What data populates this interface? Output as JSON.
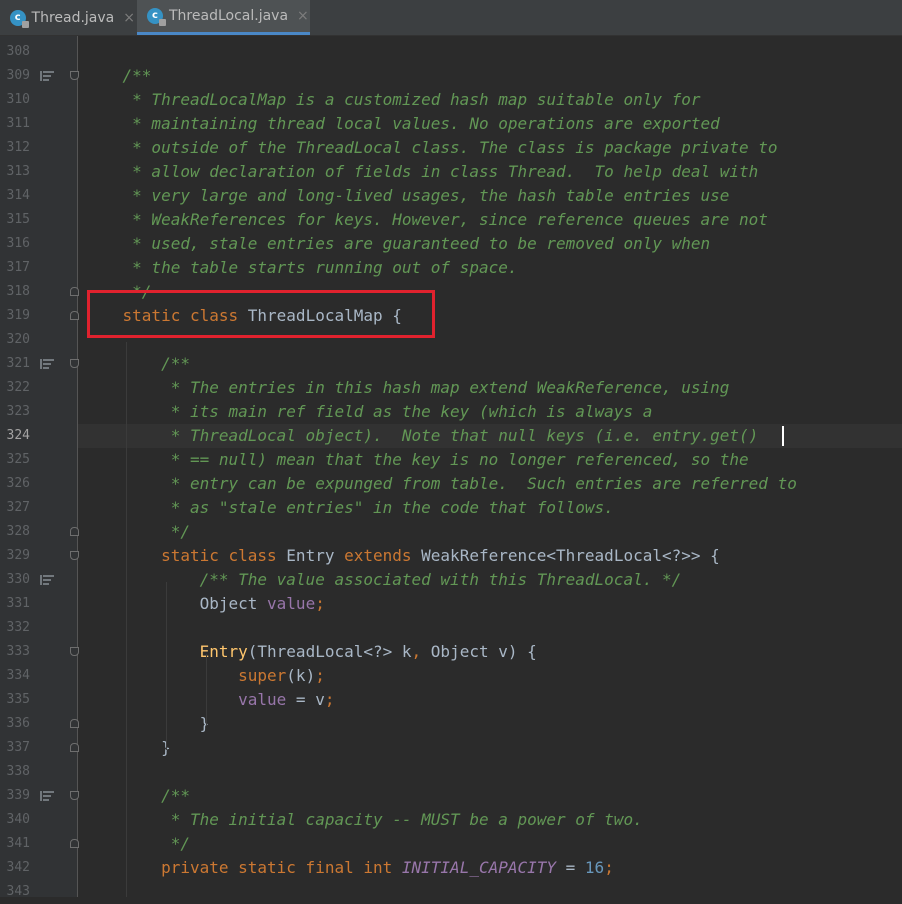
{
  "tabs": [
    {
      "label": "Thread.java",
      "icon": "java-class-icon",
      "active": false
    },
    {
      "label": "ThreadLocal.java",
      "icon": "java-class-icon",
      "active": true
    }
  ],
  "tab_close_glyph": "×",
  "file_icon_letter": "c",
  "colors": {
    "comment": "#629755",
    "keyword": "#cc7832",
    "field": "#9876aa",
    "number": "#6897bb",
    "method": "#ffc66d",
    "text": "#a9b7c6",
    "highlight_box": "#e0222e"
  },
  "current_line": 324,
  "highlighted_line": 319,
  "lines": [
    {
      "n": "308",
      "t": []
    },
    {
      "n": "309",
      "t": [
        [
          "comment",
          "    /**"
        ]
      ]
    },
    {
      "n": "310",
      "t": [
        [
          "comment",
          "     * ThreadLocalMap is a customized hash map suitable only for"
        ]
      ]
    },
    {
      "n": "311",
      "t": [
        [
          "comment",
          "     * maintaining thread local values. No operations are exported"
        ]
      ]
    },
    {
      "n": "312",
      "t": [
        [
          "comment",
          "     * outside of the ThreadLocal class. The class is package private to"
        ]
      ]
    },
    {
      "n": "313",
      "t": [
        [
          "comment",
          "     * allow declaration of fields in class Thread.  To help deal with"
        ]
      ]
    },
    {
      "n": "314",
      "t": [
        [
          "comment",
          "     * very large and long-lived usages, the hash table entries use"
        ]
      ]
    },
    {
      "n": "315",
      "t": [
        [
          "comment",
          "     * WeakReferences for keys. However, since reference queues are not"
        ]
      ]
    },
    {
      "n": "316",
      "t": [
        [
          "comment",
          "     * used, stale entries are guaranteed to be removed only when"
        ]
      ]
    },
    {
      "n": "317",
      "t": [
        [
          "comment",
          "     * the table starts running out of space."
        ]
      ]
    },
    {
      "n": "318",
      "t": [
        [
          "comment",
          "     */"
        ]
      ]
    },
    {
      "n": "319",
      "t": [
        [
          "kw",
          "    static class "
        ],
        [
          "plain",
          "ThreadLocalMap {"
        ]
      ]
    },
    {
      "n": "320",
      "t": []
    },
    {
      "n": "321",
      "t": [
        [
          "comment",
          "        /**"
        ]
      ]
    },
    {
      "n": "322",
      "t": [
        [
          "comment",
          "         * The entries in this hash map extend WeakReference, using"
        ]
      ]
    },
    {
      "n": "323",
      "t": [
        [
          "comment",
          "         * its main ref field as the key (which is always a"
        ]
      ]
    },
    {
      "n": "324",
      "t": [
        [
          "comment",
          "         * ThreadLocal object).  Note that null keys (i.e. entry.get()"
        ]
      ]
    },
    {
      "n": "325",
      "t": [
        [
          "comment",
          "         * == null) mean that the key is no longer referenced, so the"
        ]
      ]
    },
    {
      "n": "326",
      "t": [
        [
          "comment",
          "         * entry can be expunged from table.  Such entries are referred to"
        ]
      ]
    },
    {
      "n": "327",
      "t": [
        [
          "comment",
          "         * as \"stale entries\" in the code that follows."
        ]
      ]
    },
    {
      "n": "328",
      "t": [
        [
          "comment",
          "         */"
        ]
      ]
    },
    {
      "n": "329",
      "t": [
        [
          "kw",
          "        static class "
        ],
        [
          "plain",
          "Entry "
        ],
        [
          "kw",
          "extends "
        ],
        [
          "plain",
          "WeakReference<ThreadLocal<?>> {"
        ]
      ]
    },
    {
      "n": "330",
      "t": [
        [
          "comment",
          "            /** The value associated with this ThreadLocal. */"
        ]
      ]
    },
    {
      "n": "331",
      "t": [
        [
          "plain",
          "            Object "
        ],
        [
          "field",
          "value"
        ],
        [
          "kw",
          ";"
        ]
      ]
    },
    {
      "n": "332",
      "t": []
    },
    {
      "n": "333",
      "t": [
        [
          "method",
          "            Entry"
        ],
        [
          "plain",
          "(ThreadLocal<?> k"
        ],
        [
          "kw",
          ", "
        ],
        [
          "plain",
          "Object v) {"
        ]
      ]
    },
    {
      "n": "334",
      "t": [
        [
          "kw",
          "                super"
        ],
        [
          "plain",
          "(k)"
        ],
        [
          "kw",
          ";"
        ]
      ]
    },
    {
      "n": "335",
      "t": [
        [
          "field",
          "                value "
        ],
        [
          "plain",
          "= v"
        ],
        [
          "kw",
          ";"
        ]
      ]
    },
    {
      "n": "336",
      "t": [
        [
          "plain",
          "            }"
        ]
      ]
    },
    {
      "n": "337",
      "t": [
        [
          "plain",
          "        }"
        ]
      ]
    },
    {
      "n": "338",
      "t": []
    },
    {
      "n": "339",
      "t": [
        [
          "comment",
          "        /**"
        ]
      ]
    },
    {
      "n": "340",
      "t": [
        [
          "comment",
          "         * The initial capacity -- MUST be a power of two."
        ]
      ]
    },
    {
      "n": "341",
      "t": [
        [
          "comment",
          "         */"
        ]
      ]
    },
    {
      "n": "342",
      "t": [
        [
          "kw",
          "        private static final int "
        ],
        [
          "const",
          "INITIAL_CAPACITY "
        ],
        [
          "plain",
          "= "
        ],
        [
          "num",
          "16"
        ],
        [
          "kw",
          ";"
        ]
      ]
    },
    {
      "n": "343",
      "t": []
    }
  ]
}
